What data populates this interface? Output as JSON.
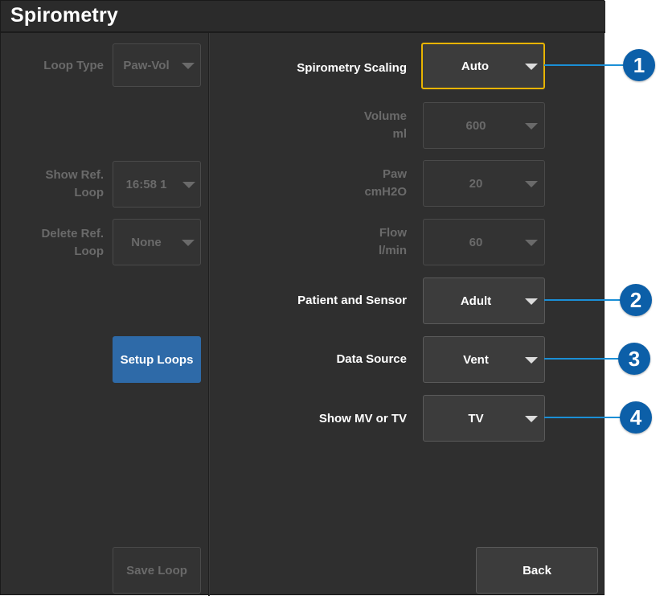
{
  "window": {
    "title": "Spirometry"
  },
  "left": {
    "loop_type": {
      "label": "Loop Type",
      "value": "Paw-Vol"
    },
    "show_ref_loop": {
      "label_line1": "Show Ref.",
      "label_line2": "Loop",
      "value": "16:58 1"
    },
    "delete_ref_loop": {
      "label_line1": "Delete Ref.",
      "label_line2": "Loop",
      "value": "None"
    },
    "setup_loops_label": "Setup Loops",
    "save_loop_label": "Save Loop"
  },
  "right": {
    "spirometry_scaling": {
      "label": "Spirometry Scaling",
      "value": "Auto"
    },
    "volume": {
      "label_line1": "Volume",
      "label_line2": "ml",
      "value": "600"
    },
    "paw": {
      "label_line1": "Paw",
      "label_line2": "cmH2O",
      "value": "20"
    },
    "flow": {
      "label_line1": "Flow",
      "label_line2": "l/min",
      "value": "60"
    },
    "patient_and_sensor": {
      "label": "Patient and Sensor",
      "value": "Adult"
    },
    "data_source": {
      "label": "Data Source",
      "value": "Vent"
    },
    "show_mv_or_tv": {
      "label": "Show MV or TV",
      "value": "TV"
    },
    "back_label": "Back"
  },
  "callouts": [
    "1",
    "2",
    "3",
    "4"
  ],
  "colors": {
    "panel": "#2f2f2f",
    "focus_border": "#e8b400",
    "primary_button": "#2e6aa8",
    "callout_fill": "#0c5fa8",
    "callout_line": "#1b8fd6",
    "disabled_text": "#6a6a6a"
  },
  "icons": {
    "dropdown_caret": "caret-down-icon"
  }
}
